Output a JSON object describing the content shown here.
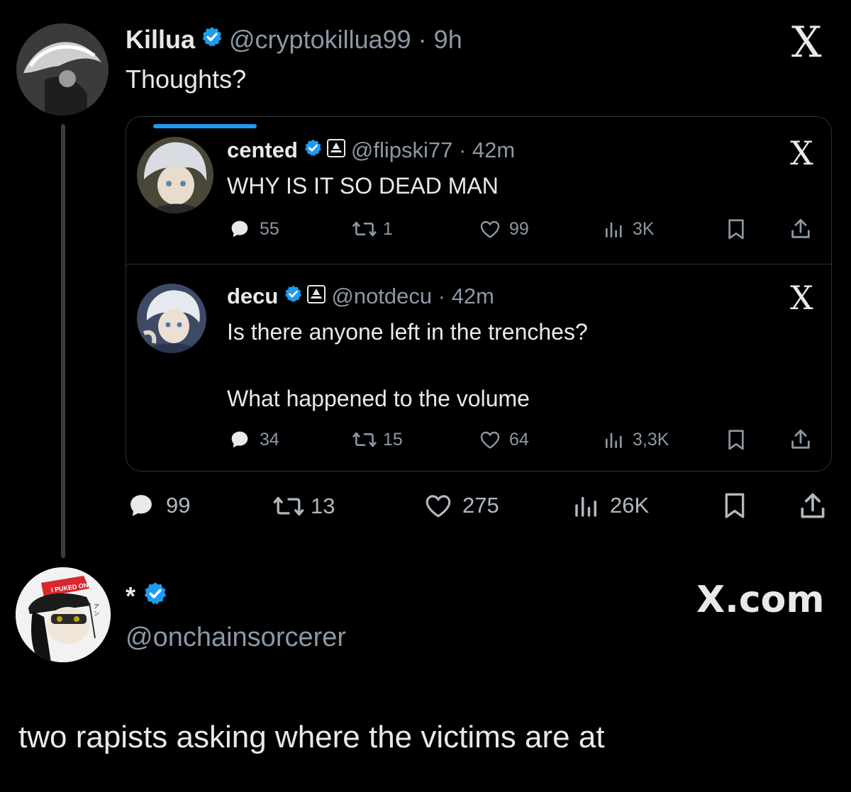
{
  "main_post": {
    "name": "Killua",
    "handle_time": "@cryptokillua99 · 9h",
    "text": "Thoughts?",
    "stats": {
      "replies": "99",
      "reposts": "13",
      "likes": "275",
      "views": "26K"
    }
  },
  "quoted": [
    {
      "name": "cented",
      "handle_time": "@flipski77 · 42m",
      "text_lines": [
        "WHY IS IT SO DEAD MAN"
      ],
      "stats": {
        "replies": "55",
        "reposts": "1",
        "likes": "99",
        "views": "3K"
      }
    },
    {
      "name": "decu",
      "handle_time": "@notdecu · 42m",
      "text_lines": [
        "Is there anyone left in the trenches?",
        "What happened to the volume"
      ],
      "stats": {
        "replies": "34",
        "reposts": "15",
        "likes": "64",
        "views": "3,3K"
      }
    }
  ],
  "reply": {
    "name": "*",
    "handle": "@onchainsorcerer",
    "text": "two rapists asking where the victims are at",
    "avatar_caption": "I PUKED ON"
  },
  "x_logo": "X",
  "watermark": "X.com",
  "colors": {
    "verified": "#1d9bf0",
    "accent": "#1d9bf0",
    "muted": "#8b98a5",
    "text": "#e7e9ea"
  }
}
